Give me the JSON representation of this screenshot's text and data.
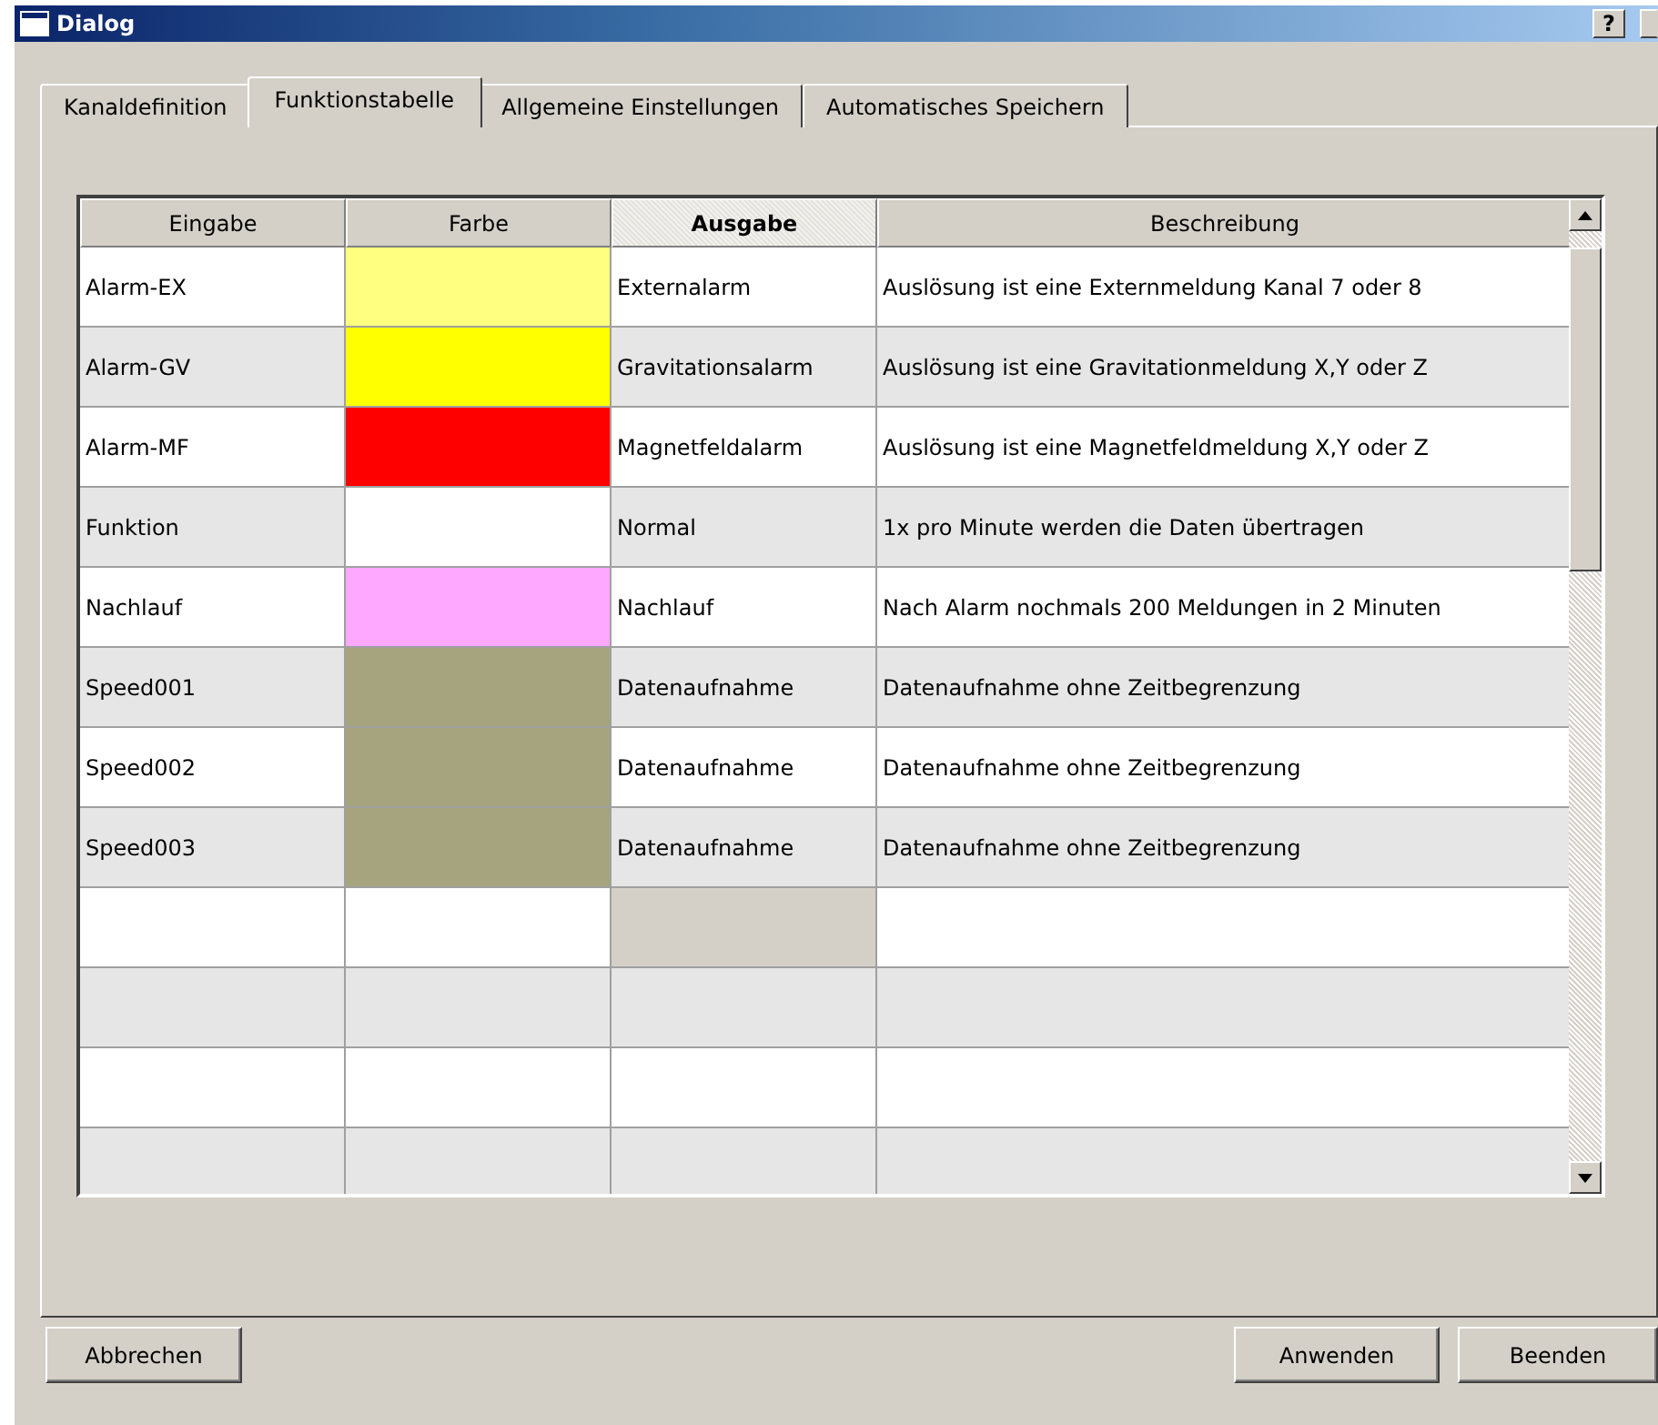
{
  "window": {
    "title": "Dialog",
    "help_button": "?"
  },
  "tabs": [
    {
      "label": "Kanaldefinition",
      "selected": false
    },
    {
      "label": "Funktionstabelle",
      "selected": true
    },
    {
      "label": "Allgemeine Einstellungen",
      "selected": false
    },
    {
      "label": "Automatisches Speichern",
      "selected": false
    }
  ],
  "table": {
    "columns": [
      {
        "label": "Eingabe",
        "selected": false
      },
      {
        "label": "Farbe",
        "selected": false
      },
      {
        "label": "Ausgabe",
        "selected": true
      },
      {
        "label": "Beschreibung",
        "selected": false
      }
    ],
    "rows": [
      {
        "eingabe": "Alarm-EX",
        "color": "#ffff80",
        "ausgabe": "Externalarm",
        "beschreibung": "Auslösung ist eine Externmeldung Kanal 7 oder 8",
        "selected": false
      },
      {
        "eingabe": "Alarm-GV",
        "color": "#ffff00",
        "ausgabe": "Gravitationsalarm",
        "beschreibung": "Auslösung ist eine Gravitationmeldung X,Y oder Z",
        "selected": false
      },
      {
        "eingabe": "Alarm-MF",
        "color": "#ff0000",
        "ausgabe": "Magnetfeldalarm",
        "beschreibung": "Auslösung ist eine Magnetfeldmeldung X,Y oder Z",
        "selected": false
      },
      {
        "eingabe": "Funktion",
        "color": "#ffffff",
        "ausgabe": "Normal",
        "beschreibung": "1x pro Minute werden die Daten übertragen",
        "selected": false
      },
      {
        "eingabe": "Nachlauf",
        "color": "#ffa8ff",
        "ausgabe": "Nachlauf",
        "beschreibung": "Nach Alarm  nochmals 200 Meldungen in 2 Minuten",
        "selected": false
      },
      {
        "eingabe": "Speed001",
        "color": "#a6a47e",
        "ausgabe": "Datenaufnahme",
        "beschreibung": "Datenaufnahme ohne Zeitbegrenzung",
        "selected": false
      },
      {
        "eingabe": "Speed002",
        "color": "#a6a47e",
        "ausgabe": "Datenaufnahme",
        "beschreibung": "Datenaufnahme ohne Zeitbegrenzung",
        "selected": false
      },
      {
        "eingabe": "Speed003",
        "color": "#a6a47e",
        "ausgabe": "Datenaufnahme",
        "beschreibung": "Datenaufnahme ohne Zeitbegrenzung",
        "selected": false
      },
      {
        "selected": true
      },
      {
        "selected": false
      },
      {
        "selected": false
      },
      {
        "selected": false
      }
    ]
  },
  "buttons": {
    "left": [
      "Abbrechen"
    ],
    "right": [
      "Anwenden",
      "Beenden"
    ]
  }
}
